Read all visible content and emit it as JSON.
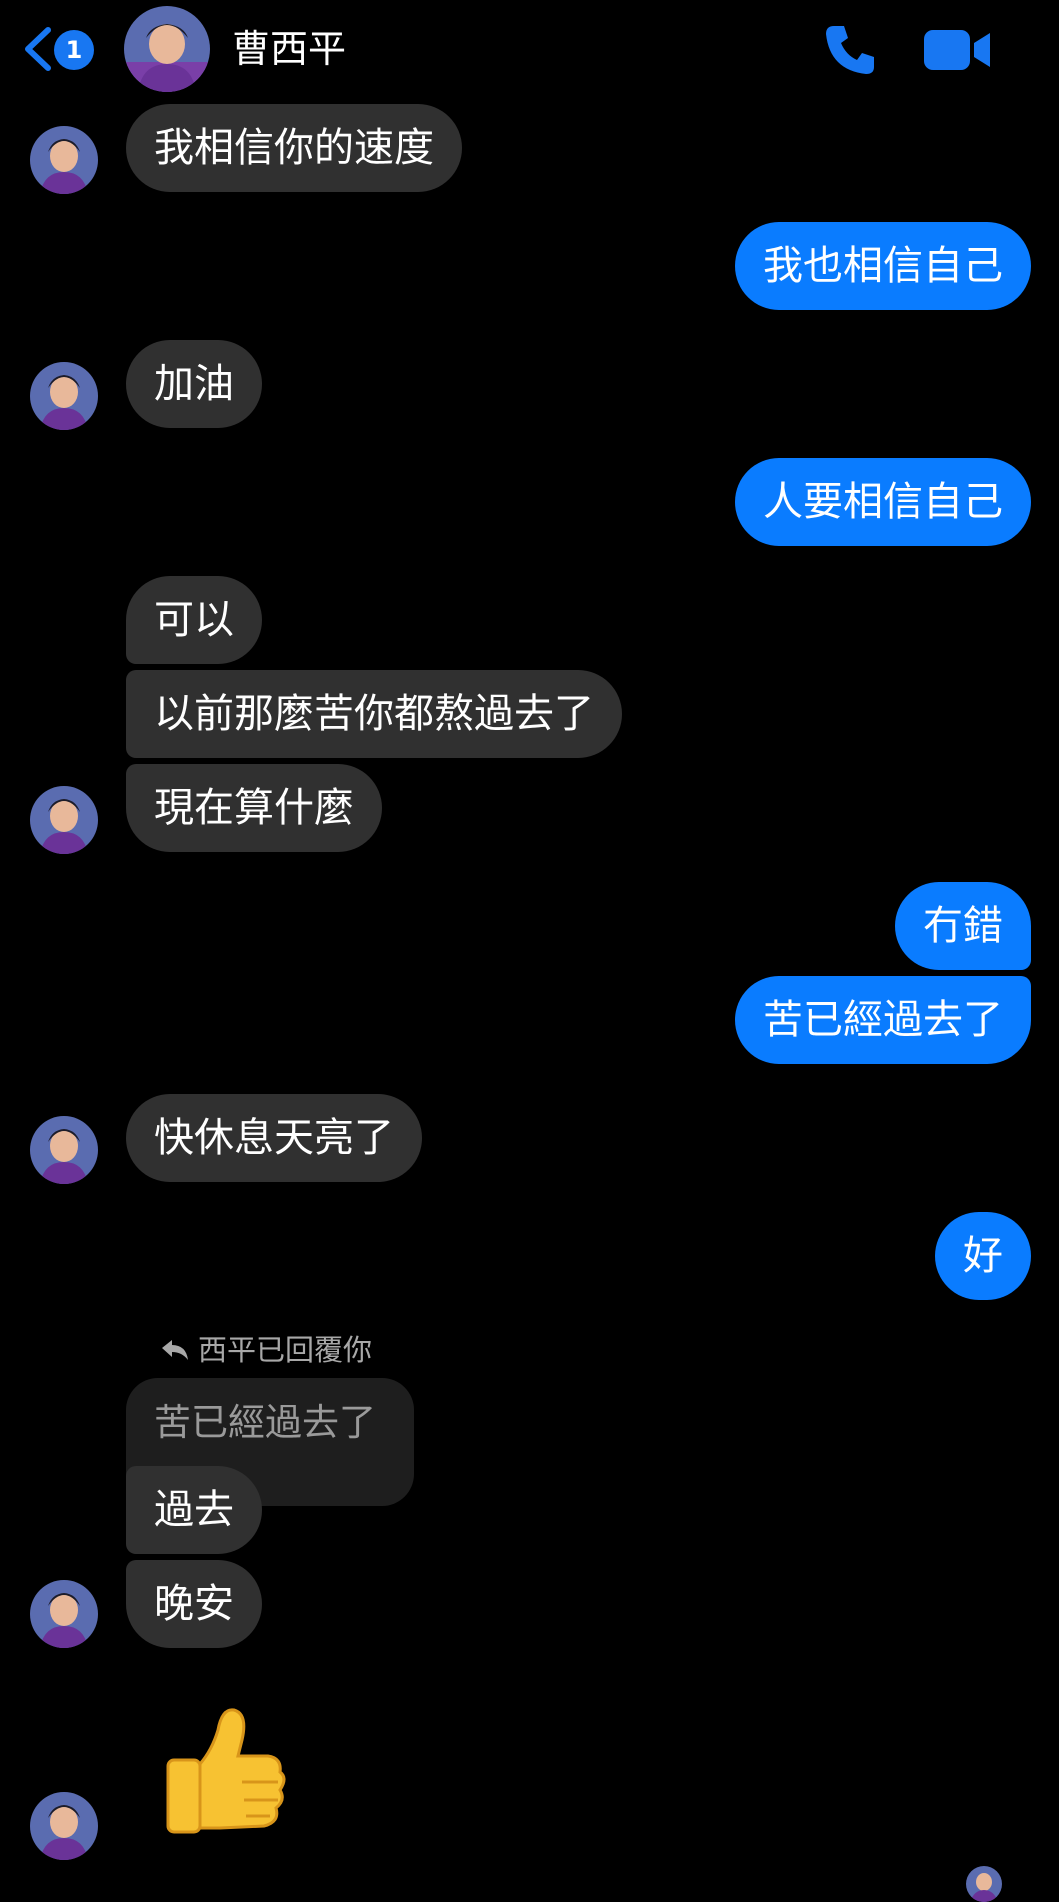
{
  "header": {
    "unread_count": "1",
    "contact_name": "曹西平"
  },
  "messages": [
    {
      "side": "in",
      "text": "我相信你的速度"
    },
    {
      "side": "out",
      "text": "我也相信自己"
    },
    {
      "side": "in",
      "text": "加油"
    },
    {
      "side": "out",
      "text": "人要相信自己"
    },
    {
      "side": "in",
      "text": "可以"
    },
    {
      "side": "in",
      "text": "以前那麼苦你都熬過去了"
    },
    {
      "side": "in",
      "text": "現在算什麼"
    },
    {
      "side": "out",
      "text": "冇錯"
    },
    {
      "side": "out",
      "text": "苦已經過去了"
    },
    {
      "side": "in",
      "text": "快休息天亮了"
    },
    {
      "side": "out",
      "text": "好"
    },
    {
      "side": "in",
      "text": "過去"
    },
    {
      "side": "in",
      "text": "晚安"
    }
  ],
  "reply": {
    "label": "西平已回覆你",
    "quoted_text": "苦已經過去了"
  },
  "colors": {
    "background": "#000000",
    "incoming_bubble": "#303030",
    "outgoing_bubble": "#0a7cff",
    "accent": "#1877f2"
  },
  "icons": [
    "back-chevron-icon",
    "phone-icon",
    "video-camera-icon",
    "reply-arrow-icon",
    "thumbs-up-icon"
  ]
}
